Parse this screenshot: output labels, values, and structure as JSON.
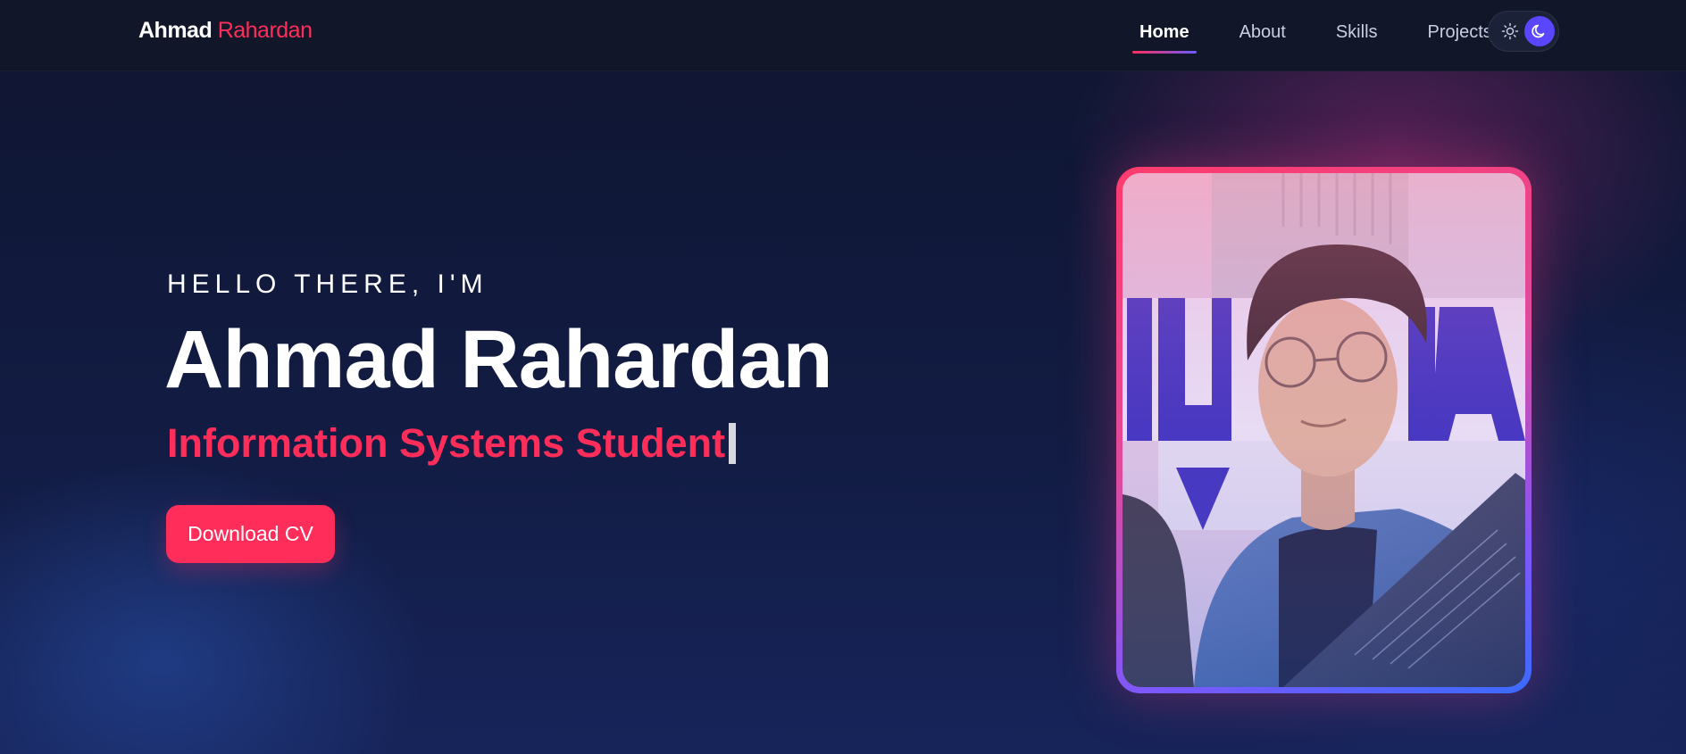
{
  "navbar": {
    "brand_first": "Ahmad",
    "brand_last": "Rahardan",
    "links": [
      {
        "label": "Home",
        "active": true
      },
      {
        "label": "About",
        "active": false
      },
      {
        "label": "Skills",
        "active": false
      },
      {
        "label": "Projects",
        "active": false
      }
    ],
    "theme_toggle": {
      "light_icon": "sun-icon",
      "dark_icon": "moon-icon",
      "selected": "dark"
    }
  },
  "hero": {
    "greeting": "HELLO THERE, I'M",
    "name": "Ahmad Rahardan",
    "role": "Information Systems Student",
    "cta_label": "Download CV"
  },
  "profile": {
    "image": "profile-photo"
  },
  "colors": {
    "accent": "#ff2d5a",
    "toggle_active": "#5a46ff",
    "background": "#121c44",
    "navbar": "#111729"
  }
}
